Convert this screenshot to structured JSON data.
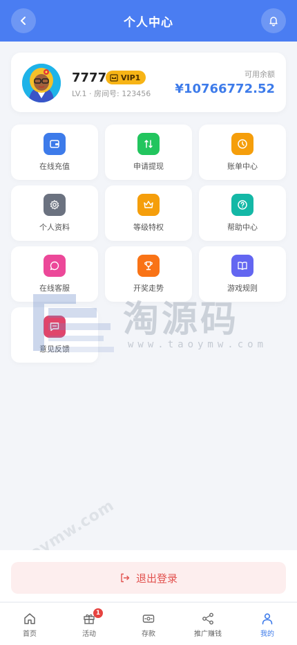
{
  "header": {
    "title": "个人中心",
    "back_icon": "chevron-left-icon",
    "bell_icon": "bell-icon"
  },
  "profile": {
    "username": "7777",
    "vip_label": "VIP1",
    "sub_info": "LV.1 · 房间号: 123456",
    "balance_label": "可用余额",
    "balance_value": "¥10766772.52"
  },
  "menu": [
    {
      "label": "在线充值",
      "icon": "wallet-icon",
      "color": "#3d7bea"
    },
    {
      "label": "申请提现",
      "icon": "swap-icon",
      "color": "#22c55e"
    },
    {
      "label": "账单中心",
      "icon": "clock-icon",
      "color": "#f59e0b"
    },
    {
      "label": "个人资料",
      "icon": "gear-icon",
      "color": "#6b7280"
    },
    {
      "label": "等级特权",
      "icon": "crown-icon",
      "color": "#f59e0b"
    },
    {
      "label": "帮助中心",
      "icon": "help-icon",
      "color": "#14b8a6"
    },
    {
      "label": "在线客服",
      "icon": "chat-icon",
      "color": "#ec4899"
    },
    {
      "label": "开奖走势",
      "icon": "trophy-icon",
      "color": "#f97316"
    },
    {
      "label": "游戏规则",
      "icon": "book-icon",
      "color": "#6366f1"
    },
    {
      "label": "意见反馈",
      "icon": "message-icon",
      "color": "#e0456b"
    }
  ],
  "watermark": {
    "main": "淘源码",
    "url": "www.taoymw.com",
    "diagonal": "taoymw.com"
  },
  "logout": {
    "label": "退出登录",
    "icon": "logout-icon"
  },
  "tabs": [
    {
      "label": "首页",
      "icon": "home-icon",
      "active": false
    },
    {
      "label": "活动",
      "icon": "gift-icon",
      "active": false,
      "badge": "1"
    },
    {
      "label": "存款",
      "icon": "card-icon",
      "active": false
    },
    {
      "label": "推广赚钱",
      "icon": "share-icon",
      "active": false
    },
    {
      "label": "我的",
      "icon": "user-icon",
      "active": true
    }
  ]
}
